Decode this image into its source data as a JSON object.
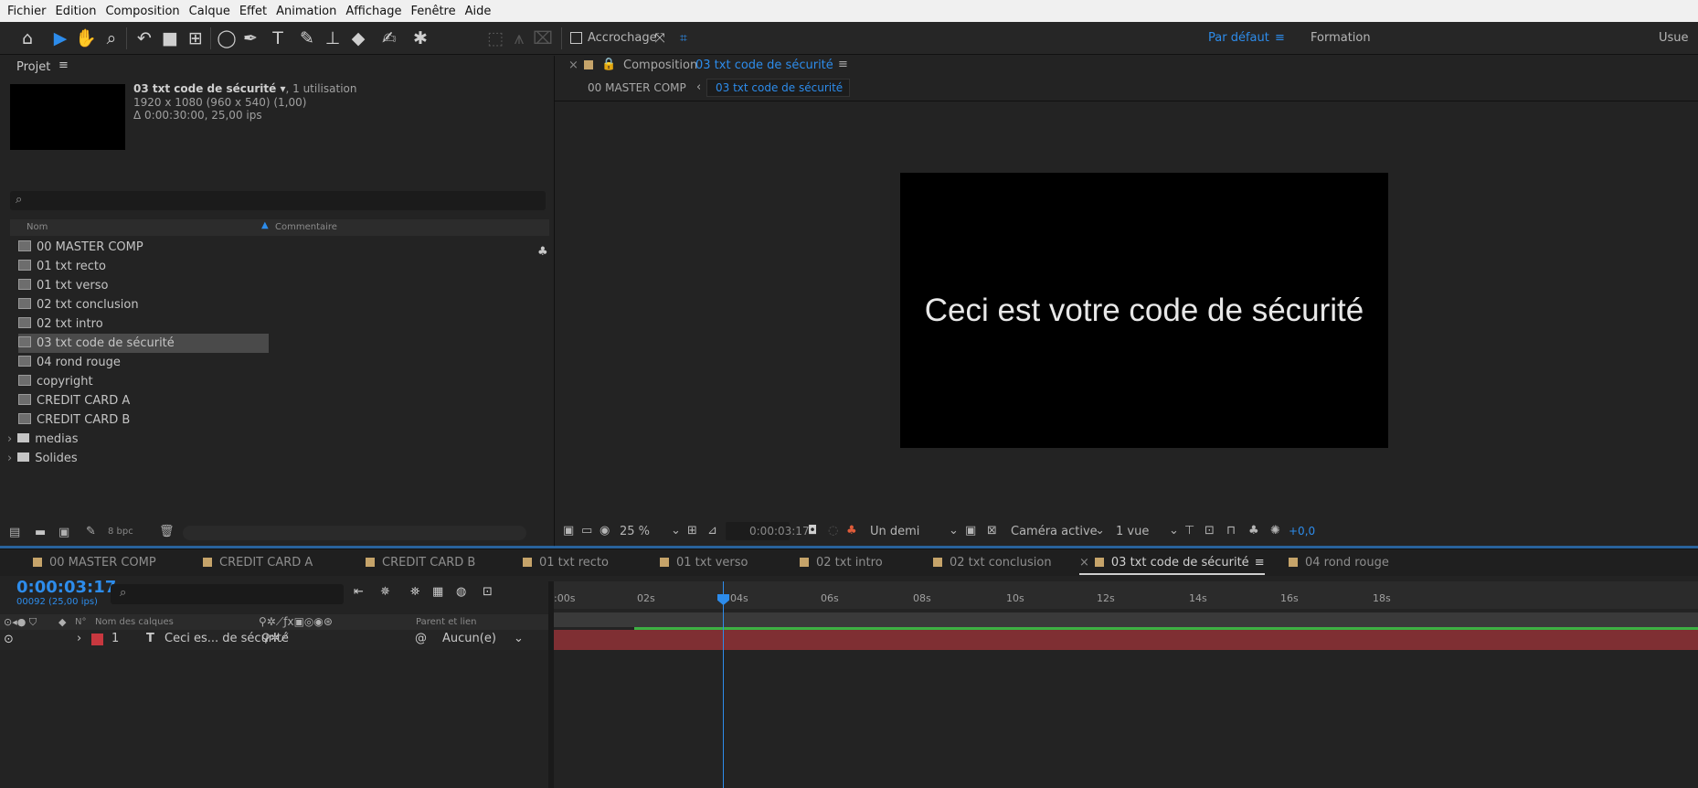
{
  "menu": [
    "Fichier",
    "Edition",
    "Composition",
    "Calque",
    "Effet",
    "Animation",
    "Affichage",
    "Fenêtre",
    "Aide"
  ],
  "toolbar": {
    "snapping_label": "Accrochage",
    "workspaces": [
      "Par défaut",
      "Formation",
      "Usue"
    ]
  },
  "project": {
    "title": "Projet",
    "selected_name": "03 txt code de sécurité",
    "selected_usage": ", 1 utilisation",
    "selected_dims": "1920 x 1080  (960 x 540) (1,00)",
    "selected_duration": "Δ 0:00:30:00, 25,00 ips",
    "col_name": "Nom",
    "col_comment": "Commentaire",
    "items": [
      {
        "label": "00 MASTER COMP",
        "type": "comp"
      },
      {
        "label": "01 txt recto",
        "type": "comp"
      },
      {
        "label": "01 txt verso",
        "type": "comp"
      },
      {
        "label": "02 txt conclusion",
        "type": "comp"
      },
      {
        "label": "02 txt intro",
        "type": "comp"
      },
      {
        "label": "03 txt code de sécurité",
        "type": "comp"
      },
      {
        "label": "04 rond rouge",
        "type": "comp"
      },
      {
        "label": "copyright",
        "type": "comp"
      },
      {
        "label": "CREDIT CARD A",
        "type": "comp"
      },
      {
        "label": "CREDIT CARD B",
        "type": "comp"
      },
      {
        "label": "medias",
        "type": "folder"
      },
      {
        "label": "Solides",
        "type": "folder"
      }
    ],
    "bpc": "8 bpc"
  },
  "viewer": {
    "tab_prefix": "Composition",
    "tab_name": "03 txt code de sécurité",
    "crumb_parent": "00 MASTER COMP",
    "crumb_current": "03 txt code de sécurité",
    "canvas_text": "Ceci est votre code de sécurité",
    "zoom": "25 %",
    "timecode": "0:00:03:17",
    "resolution": "Un demi",
    "camera": "Caméra active",
    "views": "1 vue",
    "exposure": "+0,0"
  },
  "timeline_tabs": [
    {
      "label": "00 MASTER COMP",
      "active": false
    },
    {
      "label": "CREDIT CARD A",
      "active": false
    },
    {
      "label": "CREDIT CARD B",
      "active": false
    },
    {
      "label": "01 txt recto",
      "active": false
    },
    {
      "label": "01 txt verso",
      "active": false
    },
    {
      "label": "02 txt intro",
      "active": false
    },
    {
      "label": "02 txt conclusion",
      "active": false
    },
    {
      "label": "03 txt code de sécurité",
      "active": true
    },
    {
      "label": "04 rond rouge",
      "active": false
    }
  ],
  "timeline": {
    "timecode": "0:00:03:17",
    "frames": "00092 (25,00 ips)",
    "col_num": "N°",
    "col_layer_name": "Nom des calques",
    "col_parent": "Parent et lien",
    "ticks": [
      ":00s",
      "02s",
      "04s",
      "06s",
      "08s",
      "10s",
      "12s",
      "14s",
      "16s",
      "18s"
    ],
    "layer": {
      "num": "1",
      "type": "T",
      "name": "Ceci es... de sécurité",
      "parent": "Aucun(e)"
    }
  },
  "colors": {
    "accent": "#2d8ceb",
    "comp_label": "#c6a46a",
    "layer_red": "#c8383f",
    "layer_bar": "#7f2f33",
    "green": "#3cb043"
  }
}
